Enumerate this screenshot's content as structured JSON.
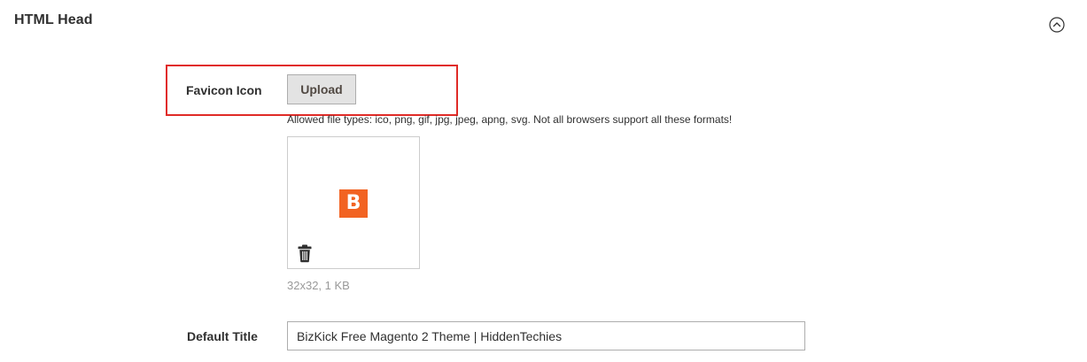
{
  "section": {
    "title": "HTML Head",
    "toggle_icon": "chevron-up-circle-icon"
  },
  "favicon": {
    "label": "Favicon Icon",
    "upload_label": "Upload",
    "allowed_types_note": "Allowed file types: ico, png, gif, jpg, jpeg, apng, svg. Not all browsers support all these formats!",
    "preview_letter": "B",
    "preview_color": "#f26322",
    "file_meta": "32x32, 1 KB",
    "delete_icon": "trash-icon"
  },
  "default_title": {
    "label": "Default Title",
    "value": "BizKick Free Magento 2 Theme | HiddenTechies"
  },
  "colors": {
    "highlight": "#e02b27",
    "button_bg": "#e3e3e3"
  }
}
